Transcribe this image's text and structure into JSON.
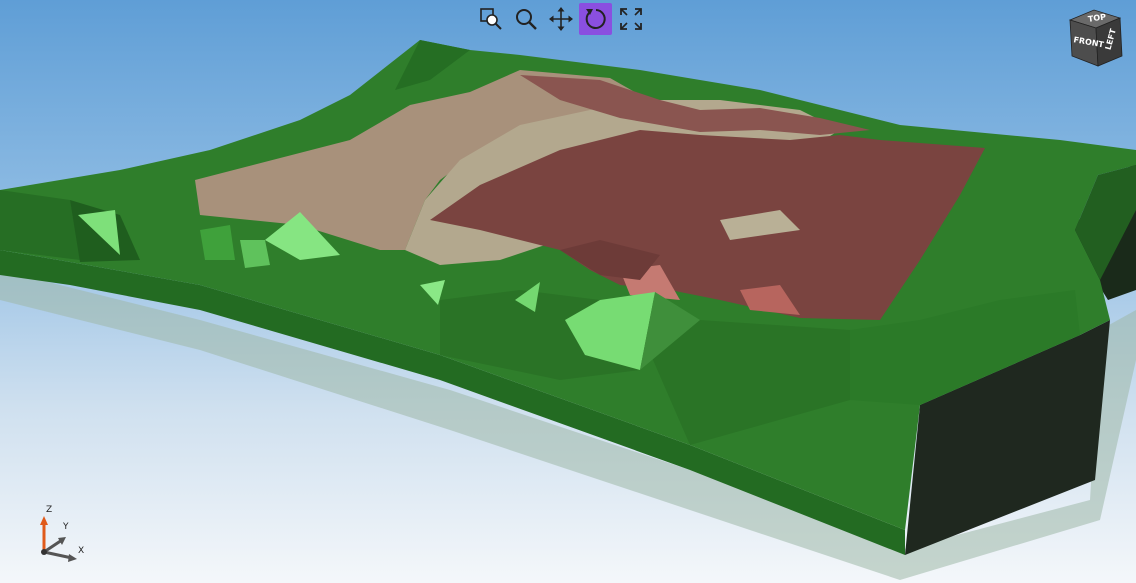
{
  "toolbar": {
    "tools": [
      {
        "name": "zoom-window",
        "icon": "zoom-window-icon",
        "active": false
      },
      {
        "name": "zoom",
        "icon": "magnifier-icon",
        "active": false
      },
      {
        "name": "pan",
        "icon": "move-arrows-icon",
        "active": false
      },
      {
        "name": "rotate",
        "icon": "rotate-icon",
        "active": true
      },
      {
        "name": "fit-all",
        "icon": "fit-all-icon",
        "active": false
      }
    ],
    "active_color": "#8a4fe0"
  },
  "view_cube": {
    "front_label": "FRONT",
    "top_label": "TOP",
    "right_label": "LEFT"
  },
  "axis_triad": {
    "z_label": "Z",
    "y_label": "Y",
    "x_label": "X",
    "z_color": "#e05a1a"
  },
  "scene": {
    "terrain_color": "#2e7d2a",
    "highlight_color": "#7fe07a",
    "site_color": "#7a4a44",
    "pad_color": "#a89880",
    "side_color": "#1e2a1e"
  }
}
